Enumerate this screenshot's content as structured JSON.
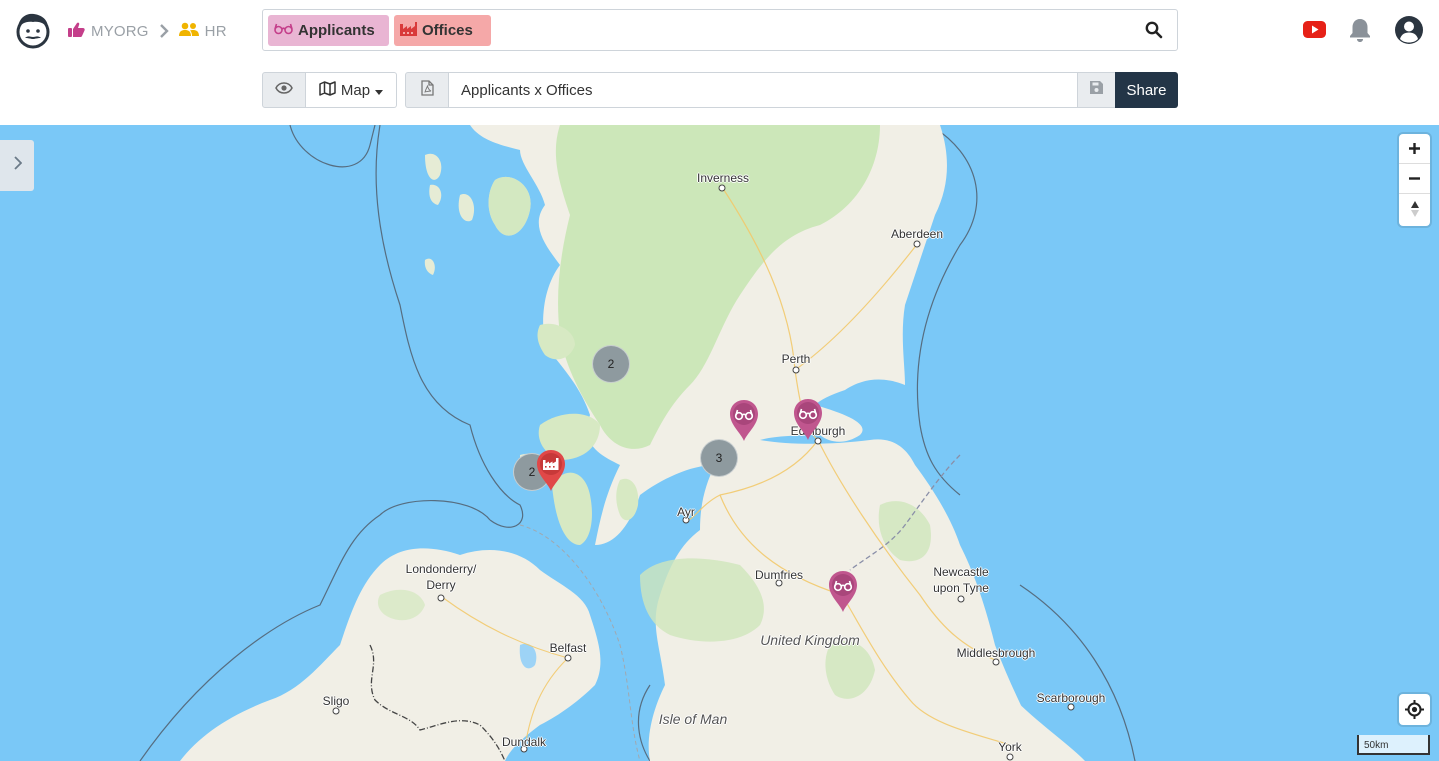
{
  "breadcrumb": {
    "org": "MYORG",
    "team": "HR"
  },
  "search": {
    "chips": [
      {
        "label": "Applicants",
        "color": "#e9b5d3",
        "icon": "glasses-icon"
      },
      {
        "label": "Offices",
        "color": "#f5a8a8",
        "icon": "factory-icon"
      }
    ]
  },
  "toolbar": {
    "view_mode": "Map",
    "title_value": "Applicants x Offices",
    "share_label": "Share"
  },
  "header_icons": {
    "youtube_color": "#e62117",
    "bell_color": "#8a9199",
    "user_color": "#2b3540"
  },
  "map": {
    "places": [
      {
        "name": "Inverness"
      },
      {
        "name": "Aberdeen"
      },
      {
        "name": "Perth"
      },
      {
        "name": "Edinburgh"
      },
      {
        "name": "Ayr"
      },
      {
        "name": "Dumfries"
      },
      {
        "name": "Londonderry/\nDerry"
      },
      {
        "name": "Belfast"
      },
      {
        "name": "Newcastle\nupon Tyne"
      },
      {
        "name": "Middlesbrough"
      },
      {
        "name": "Scarborough"
      },
      {
        "name": "Sligo"
      },
      {
        "name": "Dundalk"
      },
      {
        "name": "York"
      }
    ],
    "regions": [
      {
        "name": "United Kingdom"
      },
      {
        "name": "Isle of Man"
      }
    ],
    "clusters": [
      {
        "count": "2"
      },
      {
        "count": "3"
      },
      {
        "count": "2"
      }
    ],
    "markers": [
      {
        "type": "applicant",
        "color": "#c0568e"
      },
      {
        "type": "applicant",
        "color": "#c0568e"
      },
      {
        "type": "applicant",
        "color": "#c0568e"
      },
      {
        "type": "office",
        "color": "#e04848"
      }
    ],
    "scale_label": "50km",
    "sea_color": "#7ac8f7",
    "land_color": "#f1efe6",
    "forest_color": "#c6e5b0"
  }
}
